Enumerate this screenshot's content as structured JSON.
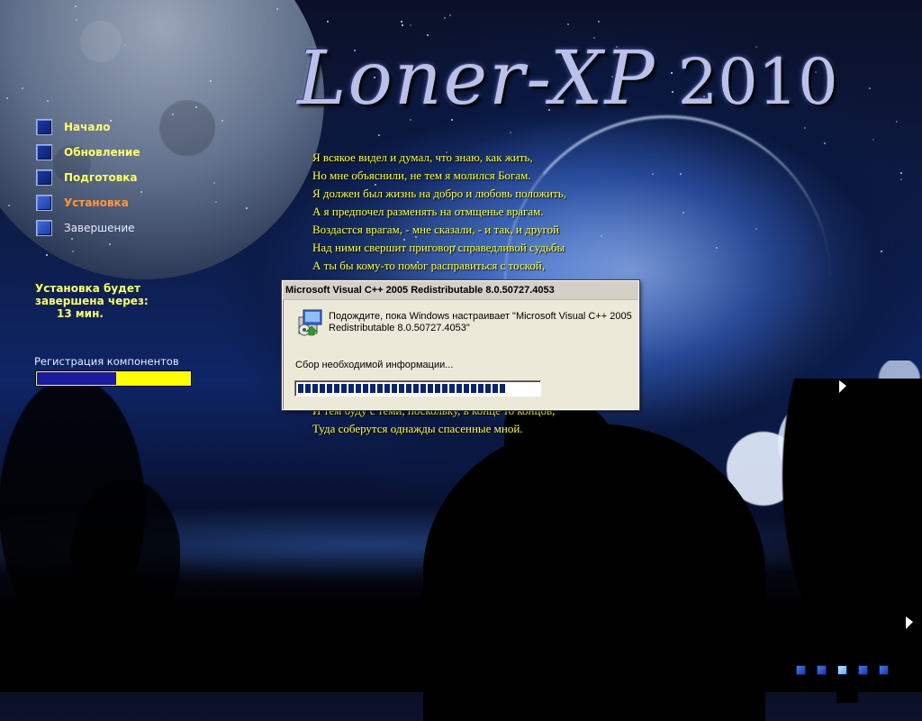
{
  "logo": {
    "name": "Loner-XP",
    "year": "2010"
  },
  "steps": [
    {
      "label": "Начало",
      "state": "done"
    },
    {
      "label": "Обновление",
      "state": "done"
    },
    {
      "label": "Подготовка",
      "state": "done"
    },
    {
      "label": "Установка",
      "state": "current"
    },
    {
      "label": "Завершение",
      "state": "pending"
    }
  ],
  "eta": {
    "line1": "Установка будет",
    "line2": "завершена через:",
    "minutes": "13 мин."
  },
  "component": {
    "label": "Регистрация компонентов",
    "progress": 0.52
  },
  "poem": {
    "lines": [
      "Я всякое видел и думал, что знаю, как жить,",
      "Но мне объяснили, не тем я молился Богам.",
      "Я должен был жизнь на добро и любовь положить,",
      "А я предпочел разменять на отмщенье врагам.",
      "Воздастся врагам, - мне сказали, - и так, и другой",
      "Над ними свершит приговор справедливой судьбы",
      "А ты бы кому-то помог расправиться с тоской,"
    ],
    "bottom_lines": [
      "И тем буду с теми, поскольку, в конце то концов,",
      "Туда соберутся однажды спасенные мной."
    ]
  },
  "dialog": {
    "title": "Microsoft Visual C++ 2005 Redistributable 8.0.50727.4053",
    "message": "Подождите, пока Windows настраивает \"Microsoft Visual C++ 2005 Redistributable 8.0.50727.4053\"",
    "status": "Сбор необходимой информации...",
    "progress": 0.9,
    "icon": "installer-package-icon"
  },
  "dots": {
    "count": 5,
    "active_index": 2
  },
  "colors": {
    "completed_step": "#ffff66",
    "current_step": "#ff9933",
    "poem_text": "#ffff44",
    "component_bar_fill": "#1a1aa0",
    "component_bar_track": "#ffff00",
    "dialog_progress": "#0a246a"
  }
}
